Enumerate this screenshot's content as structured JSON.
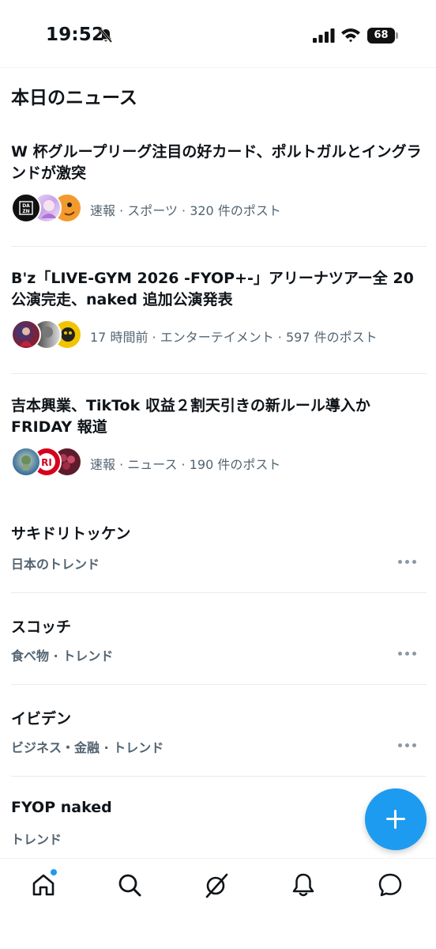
{
  "status_bar": {
    "time": "19:52",
    "battery": "68"
  },
  "section_title": "本日のニュース",
  "news": [
    {
      "headline": "W 杯グループリーグ注目の好カード、ポルトガルとイングランドが激突",
      "meta": "速報 · スポーツ · 320 件のポスト",
      "avatars": [
        "dazn-logo",
        "anime-avatar",
        "orange-avatar"
      ]
    },
    {
      "headline": "B'z「LIVE-GYM 2026 -FYOP+-」アリーナツアー全 20 公演完走、naked 追加公演発表",
      "meta": "17 時間前 · エンターテイメント · 597 件のポスト",
      "avatars": [
        "red-avatar",
        "bw-avatar",
        "yellow-avatar"
      ]
    },
    {
      "headline": "吉本興業、TikTok 収益２割天引きの新ルール導入か FRIDAY 報道",
      "meta": "速報 · ニュース · 190 件のポスト",
      "avatars": [
        "photo-avatar",
        "fri-logo",
        "berry-avatar"
      ]
    }
  ],
  "trends": [
    {
      "title": "サキドリトッケン",
      "meta": "日本のトレンド"
    },
    {
      "title": "スコッチ",
      "meta": "食べ物 · トレンド"
    },
    {
      "title": "イビデン",
      "meta": "ビジネス・金融 · トレンド"
    },
    {
      "title": "FYOP naked",
      "meta": "トレンド"
    }
  ],
  "colors": {
    "accent": "#1d9bf0",
    "text": "#0f1419",
    "secondary": "#536471"
  },
  "nav": [
    "home-icon",
    "search-icon",
    "grok-icon",
    "notifications-icon",
    "messages-icon"
  ]
}
